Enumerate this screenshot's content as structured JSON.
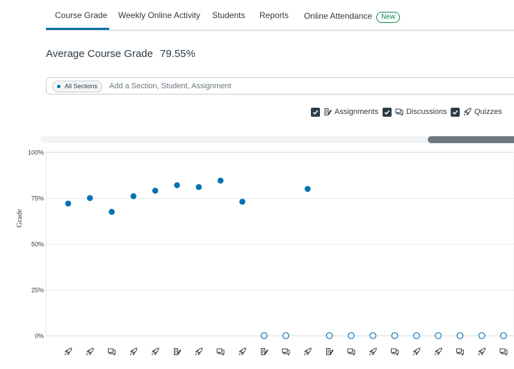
{
  "tabs": [
    {
      "label": "Course Grade",
      "active": true
    },
    {
      "label": "Weekly Online Activity",
      "active": false
    },
    {
      "label": "Students",
      "active": false
    },
    {
      "label": "Reports",
      "active": false
    },
    {
      "label": "Online Attendance",
      "badge": "New",
      "active": false
    }
  ],
  "header": {
    "label": "Average Course Grade",
    "value": "79.55%"
  },
  "filter": {
    "pill_label": "All Sections",
    "placeholder": "Add a Section, Student, Assignment"
  },
  "legend": [
    {
      "label": "Assignments",
      "icon": "assignment-icon",
      "checked": true
    },
    {
      "label": "Discussions",
      "icon": "discussion-icon",
      "checked": true
    },
    {
      "label": "Quizzes",
      "icon": "quiz-icon",
      "checked": true
    }
  ],
  "colors": {
    "accent": "#0770a3",
    "point": "#0374b5",
    "badge": "#0b874b",
    "text": "#2d3b45"
  },
  "chart_data": {
    "type": "scatter",
    "ylabel": "Grade",
    "ylim": [
      0,
      100
    ],
    "yticks": [
      "0%",
      "25%",
      "50%",
      "75%",
      "100%"
    ],
    "points": [
      {
        "type": "quiz",
        "grade": 72,
        "submitted": true
      },
      {
        "type": "quiz",
        "grade": 75,
        "submitted": true
      },
      {
        "type": "discussion",
        "grade": 67.5,
        "submitted": true
      },
      {
        "type": "quiz",
        "grade": 76,
        "submitted": true
      },
      {
        "type": "quiz",
        "grade": 79,
        "submitted": true
      },
      {
        "type": "assignment",
        "grade": 82,
        "submitted": true
      },
      {
        "type": "quiz",
        "grade": 81,
        "submitted": true
      },
      {
        "type": "discussion",
        "grade": 84.5,
        "submitted": true
      },
      {
        "type": "quiz",
        "grade": 73,
        "submitted": true
      },
      {
        "type": "assignment",
        "grade": 0,
        "submitted": false
      },
      {
        "type": "discussion",
        "grade": 0,
        "submitted": false
      },
      {
        "type": "quiz",
        "grade": 80,
        "submitted": true
      },
      {
        "type": "assignment",
        "grade": 0,
        "submitted": false
      },
      {
        "type": "discussion",
        "grade": 0,
        "submitted": false
      },
      {
        "type": "quiz",
        "grade": 0,
        "submitted": false
      },
      {
        "type": "discussion",
        "grade": 0,
        "submitted": false
      },
      {
        "type": "quiz",
        "grade": 0,
        "submitted": false
      },
      {
        "type": "quiz",
        "grade": 0,
        "submitted": false
      },
      {
        "type": "discussion",
        "grade": 0,
        "submitted": false
      },
      {
        "type": "quiz",
        "grade": 0,
        "submitted": false
      },
      {
        "type": "discussion",
        "grade": 0,
        "submitted": false
      }
    ]
  }
}
